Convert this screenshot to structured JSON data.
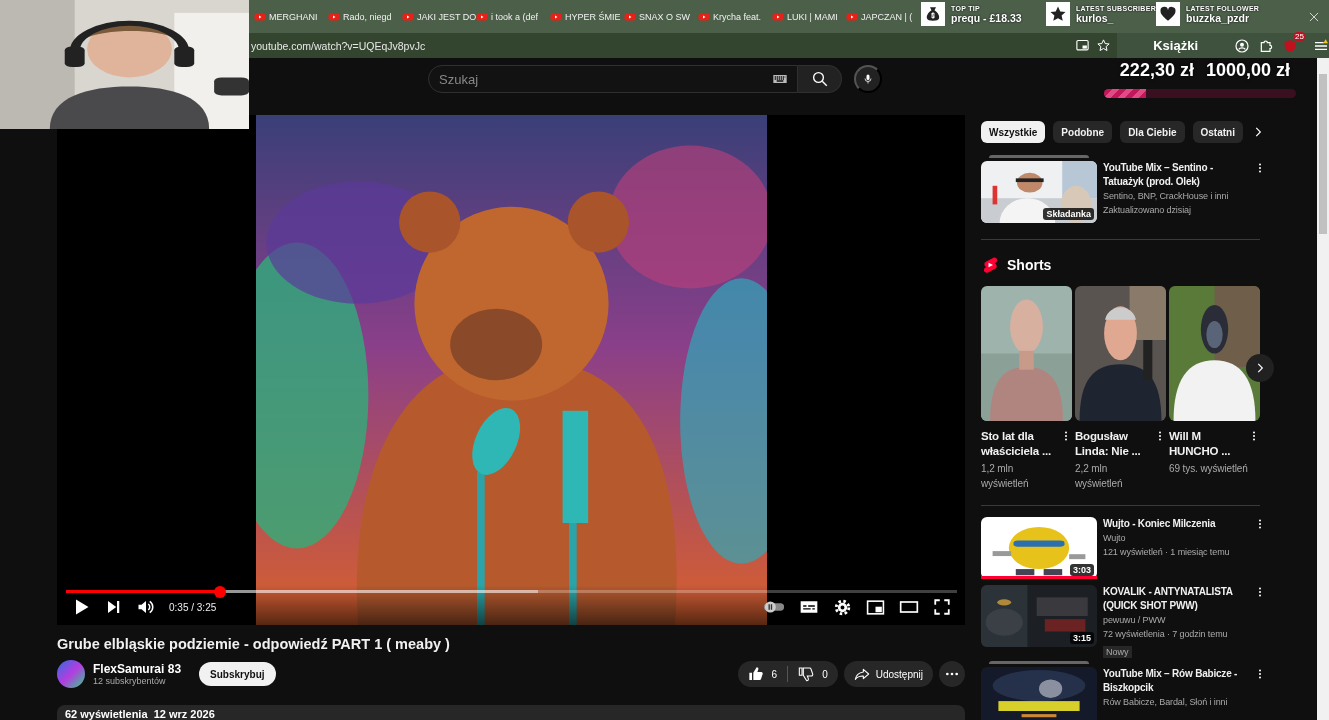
{
  "browser": {
    "tabs": [
      {
        "title": "MERGHANI"
      },
      {
        "title": "Rado, niegd"
      },
      {
        "title": "JAKI JEST DO"
      },
      {
        "title": "i took a (def"
      },
      {
        "title": "HYPER ŚMIE"
      },
      {
        "title": "SNAX O SW"
      },
      {
        "title": "Krycha feat."
      },
      {
        "title": "LUKI | MAMI"
      },
      {
        "title": "JAPCZAN | ("
      }
    ],
    "address": "youtube.com/watch?v=UQEqJv8pvJc",
    "bookmark": "Książki",
    "extension_badge": "25"
  },
  "stream_overlay": {
    "widgets": [
      {
        "kind": "tip",
        "label": "TOP TIP",
        "value": "prequ - £18.33"
      },
      {
        "kind": "subscriber",
        "label": "LATEST SUBSCRIBER",
        "value": "kurlos_"
      },
      {
        "kind": "follower",
        "label": "LATEST FOLLOWER",
        "value": "buzzka_pzdr"
      }
    ],
    "goal": {
      "current": "222,30 zł",
      "target": "1000,00 zł",
      "level": 0.22
    }
  },
  "search": {
    "placeholder": "Szukaj"
  },
  "player": {
    "level": 0.173,
    "buffer": {
      "level": 0.53
    },
    "time": "0:35 / 3:25"
  },
  "video": {
    "title": "Grube elbląskie podziemie - odpowiedź PART 1 ( meaby )",
    "channel": "FlexSamurai 83",
    "subscribers": "12 subskrybentów",
    "subscribe": "Subskrybuj",
    "likes": "6",
    "dislikes": "0",
    "share": "Udostępnij",
    "description": "62 wyświetlenia  12 wrz 2026"
  },
  "sidebar": {
    "chips": [
      {
        "label": "Wszystkie",
        "selected": true
      },
      {
        "label": "Podobne",
        "selected": false
      },
      {
        "label": "Dla Ciebie",
        "selected": false
      },
      {
        "label": "Ostatni",
        "selected": false
      }
    ],
    "items": [
      {
        "kind": "mix",
        "title": "YouTube Mix – Sentino - Tatuażyk (prod. Olek)",
        "meta": [
          "Sentino, BNP, CrackHouse i inni",
          "Zaktualizowano dzisiaj"
        ],
        "badge": "Składanka"
      },
      {
        "kind": "shorts",
        "heading": "Shorts",
        "shorts": [
          {
            "title": "Sto lat dla właściciela ...",
            "views": "1,2 mln wyświetleń"
          },
          {
            "title": "Bogusław Linda: Nie ...",
            "views": "2,2 mln wyświetleń"
          },
          {
            "title": "Will M HUNCHO ...",
            "views": "69 tys. wyświetleń"
          }
        ]
      },
      {
        "kind": "video",
        "title": "Wujto - Koniec Milczenia",
        "channel": "Wujto",
        "stats": "121 wyświetleń · 1 miesiąc temu",
        "duration": "3:03",
        "watched": true
      },
      {
        "kind": "video",
        "title": "KOVALIK - ANTYNATALISTA (QUICK SHOT PWW)",
        "channel": "pewuwu / PWW",
        "stats": "72 wyświetlenia · 7 godzin temu",
        "duration": "3:15",
        "tag": "Nowy"
      },
      {
        "kind": "mix",
        "title": "YouTube Mix – Rów Babicze - Biszkopcik",
        "meta": [
          "Rów Babicze, Bardal, Słoń i inni"
        ]
      }
    ]
  }
}
